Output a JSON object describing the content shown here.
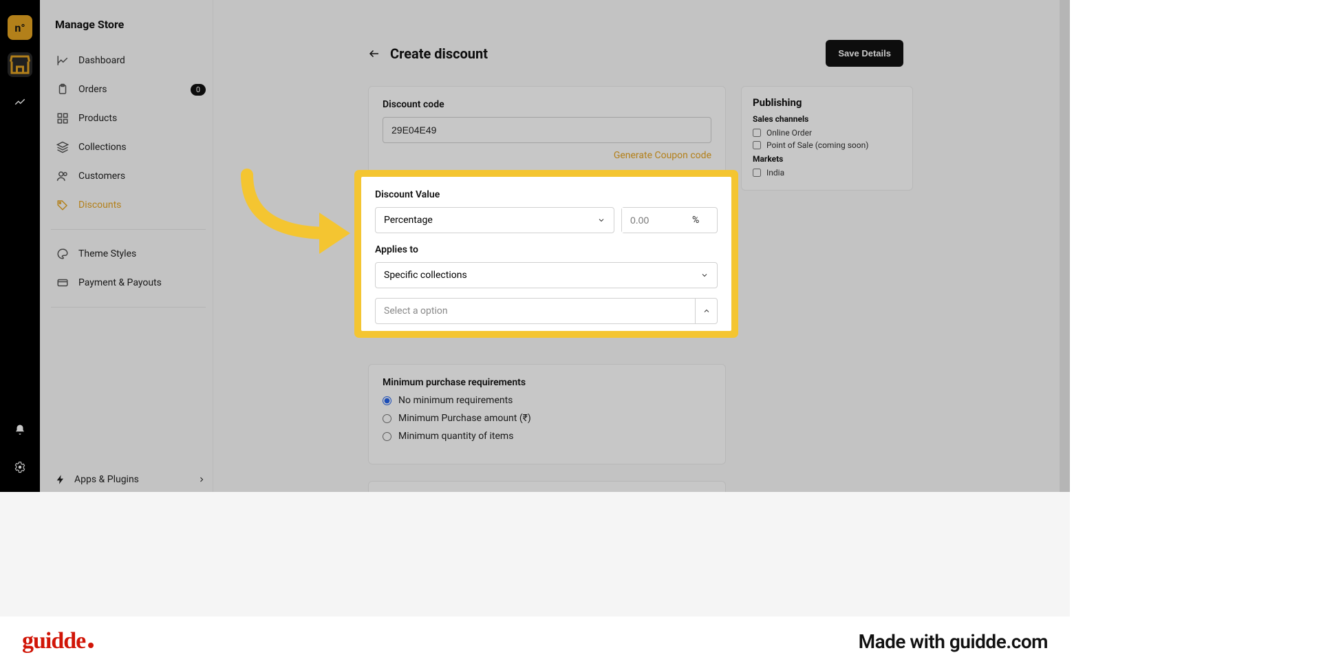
{
  "sidebar": {
    "title": "Manage Store",
    "items": [
      {
        "label": "Dashboard"
      },
      {
        "label": "Orders",
        "badge": "0"
      },
      {
        "label": "Products"
      },
      {
        "label": "Collections"
      },
      {
        "label": "Customers"
      },
      {
        "label": "Discounts"
      },
      {
        "label": "Theme Styles"
      },
      {
        "label": "Payment & Payouts"
      }
    ],
    "bottom": "Apps & Plugins"
  },
  "page": {
    "title": "Create discount",
    "save": "Save Details"
  },
  "discount_code_section": {
    "label": "Discount code",
    "value": "29E04E49",
    "generate": "Generate Coupon code"
  },
  "discount_value_section": {
    "title": "Discount Value",
    "type_selected": "Percentage",
    "value_placeholder": "0.00",
    "unit": "%",
    "applies_label": "Applies to",
    "applies_selected": "Specific collections",
    "option_placeholder": "Select a option"
  },
  "min_purchase": {
    "title": "Minimum purchase requirements",
    "opt1": "No minimum requirements",
    "opt2": "Minimum Purchase amount (₹)",
    "opt3": "Minimum quantity of items"
  },
  "publishing": {
    "title": "Publishing",
    "sales_label": "Sales channels",
    "ch1": "Online Order",
    "ch2": "Point of Sale (coming soon)",
    "markets_label": "Markets",
    "m1": "India"
  },
  "footer": {
    "logo": "guidde",
    "made": "Made with guidde.com"
  }
}
